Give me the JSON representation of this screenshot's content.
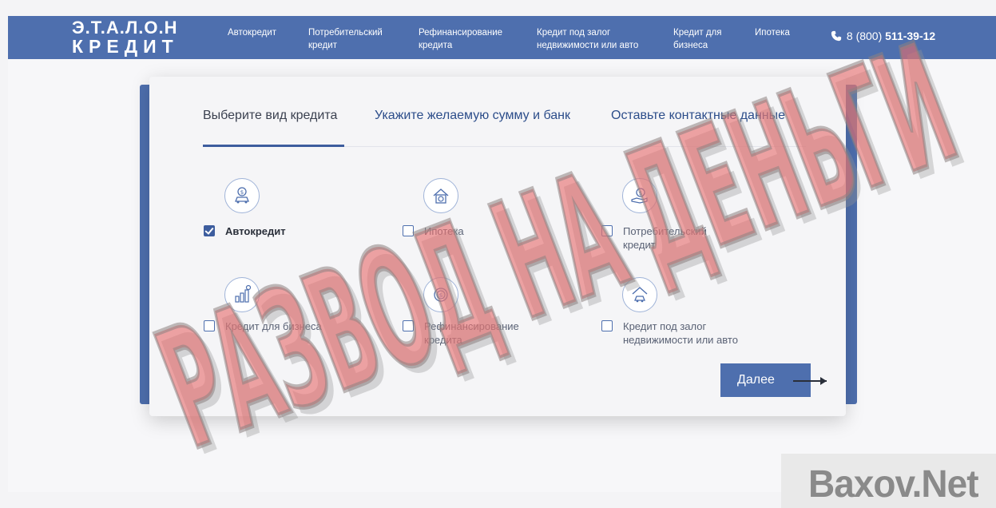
{
  "header": {
    "logo_line1": "Э.Т.А.Л.О.Н",
    "logo_line2": "КРЕДИТ",
    "nav": [
      {
        "line1": "Автокредит",
        "line2": ""
      },
      {
        "line1": "Потребительский",
        "line2": "кредит"
      },
      {
        "line1": "Рефинансирование",
        "line2": "кредита"
      },
      {
        "line1": "Кредит под залог",
        "line2": "недвижимости или авто"
      },
      {
        "line1": "Кредит для",
        "line2": "бизнеса"
      },
      {
        "line1": "Ипотека",
        "line2": ""
      }
    ],
    "phone_prefix": "8 (800)",
    "phone_number": "511-39-12"
  },
  "steps": [
    {
      "label": "Выберите вид кредита",
      "active": true
    },
    {
      "label": "Укажите желаемую сумму и банк",
      "active": false
    },
    {
      "label": "Оставьте контактные данные",
      "active": false
    }
  ],
  "options": [
    {
      "line1": "Автокредит",
      "line2": "",
      "checked": true,
      "icon": "car-money-icon"
    },
    {
      "line1": "Ипотека",
      "line2": "",
      "checked": false,
      "icon": "house-money-icon"
    },
    {
      "line1": "Потребительский",
      "line2": "кредит",
      "checked": false,
      "icon": "hand-money-icon"
    },
    {
      "line1": "Кредит для бизнеса",
      "line2": "",
      "checked": false,
      "icon": "business-chart-icon"
    },
    {
      "line1": "Рефинансирование",
      "line2": "кредита",
      "checked": false,
      "icon": "refinance-coin-icon"
    },
    {
      "line1": "Кредит под залог",
      "line2": "недвижимости или авто",
      "checked": false,
      "icon": "house-car-icon"
    }
  ],
  "next_button": "Далее",
  "overlay_stamp": "РАЗВОД НА ДЕНЬГИ",
  "watermark": "Baxov.Net",
  "colors": {
    "brand": "#4e6fae",
    "stamp": "#e66e6e"
  }
}
